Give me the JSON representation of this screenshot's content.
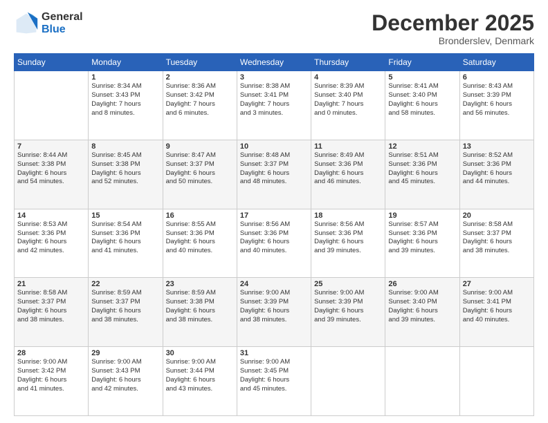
{
  "logo": {
    "general": "General",
    "blue": "Blue"
  },
  "header": {
    "month": "December 2025",
    "location": "Bronderslev, Denmark"
  },
  "days_of_week": [
    "Sunday",
    "Monday",
    "Tuesday",
    "Wednesday",
    "Thursday",
    "Friday",
    "Saturday"
  ],
  "weeks": [
    [
      {
        "day": "",
        "info": ""
      },
      {
        "day": "1",
        "info": "Sunrise: 8:34 AM\nSunset: 3:43 PM\nDaylight: 7 hours\nand 8 minutes."
      },
      {
        "day": "2",
        "info": "Sunrise: 8:36 AM\nSunset: 3:42 PM\nDaylight: 7 hours\nand 6 minutes."
      },
      {
        "day": "3",
        "info": "Sunrise: 8:38 AM\nSunset: 3:41 PM\nDaylight: 7 hours\nand 3 minutes."
      },
      {
        "day": "4",
        "info": "Sunrise: 8:39 AM\nSunset: 3:40 PM\nDaylight: 7 hours\nand 0 minutes."
      },
      {
        "day": "5",
        "info": "Sunrise: 8:41 AM\nSunset: 3:40 PM\nDaylight: 6 hours\nand 58 minutes."
      },
      {
        "day": "6",
        "info": "Sunrise: 8:43 AM\nSunset: 3:39 PM\nDaylight: 6 hours\nand 56 minutes."
      }
    ],
    [
      {
        "day": "7",
        "info": "Sunrise: 8:44 AM\nSunset: 3:38 PM\nDaylight: 6 hours\nand 54 minutes."
      },
      {
        "day": "8",
        "info": "Sunrise: 8:45 AM\nSunset: 3:38 PM\nDaylight: 6 hours\nand 52 minutes."
      },
      {
        "day": "9",
        "info": "Sunrise: 8:47 AM\nSunset: 3:37 PM\nDaylight: 6 hours\nand 50 minutes."
      },
      {
        "day": "10",
        "info": "Sunrise: 8:48 AM\nSunset: 3:37 PM\nDaylight: 6 hours\nand 48 minutes."
      },
      {
        "day": "11",
        "info": "Sunrise: 8:49 AM\nSunset: 3:36 PM\nDaylight: 6 hours\nand 46 minutes."
      },
      {
        "day": "12",
        "info": "Sunrise: 8:51 AM\nSunset: 3:36 PM\nDaylight: 6 hours\nand 45 minutes."
      },
      {
        "day": "13",
        "info": "Sunrise: 8:52 AM\nSunset: 3:36 PM\nDaylight: 6 hours\nand 44 minutes."
      }
    ],
    [
      {
        "day": "14",
        "info": "Sunrise: 8:53 AM\nSunset: 3:36 PM\nDaylight: 6 hours\nand 42 minutes."
      },
      {
        "day": "15",
        "info": "Sunrise: 8:54 AM\nSunset: 3:36 PM\nDaylight: 6 hours\nand 41 minutes."
      },
      {
        "day": "16",
        "info": "Sunrise: 8:55 AM\nSunset: 3:36 PM\nDaylight: 6 hours\nand 40 minutes."
      },
      {
        "day": "17",
        "info": "Sunrise: 8:56 AM\nSunset: 3:36 PM\nDaylight: 6 hours\nand 40 minutes."
      },
      {
        "day": "18",
        "info": "Sunrise: 8:56 AM\nSunset: 3:36 PM\nDaylight: 6 hours\nand 39 minutes."
      },
      {
        "day": "19",
        "info": "Sunrise: 8:57 AM\nSunset: 3:36 PM\nDaylight: 6 hours\nand 39 minutes."
      },
      {
        "day": "20",
        "info": "Sunrise: 8:58 AM\nSunset: 3:37 PM\nDaylight: 6 hours\nand 38 minutes."
      }
    ],
    [
      {
        "day": "21",
        "info": "Sunrise: 8:58 AM\nSunset: 3:37 PM\nDaylight: 6 hours\nand 38 minutes."
      },
      {
        "day": "22",
        "info": "Sunrise: 8:59 AM\nSunset: 3:37 PM\nDaylight: 6 hours\nand 38 minutes."
      },
      {
        "day": "23",
        "info": "Sunrise: 8:59 AM\nSunset: 3:38 PM\nDaylight: 6 hours\nand 38 minutes."
      },
      {
        "day": "24",
        "info": "Sunrise: 9:00 AM\nSunset: 3:39 PM\nDaylight: 6 hours\nand 38 minutes."
      },
      {
        "day": "25",
        "info": "Sunrise: 9:00 AM\nSunset: 3:39 PM\nDaylight: 6 hours\nand 39 minutes."
      },
      {
        "day": "26",
        "info": "Sunrise: 9:00 AM\nSunset: 3:40 PM\nDaylight: 6 hours\nand 39 minutes."
      },
      {
        "day": "27",
        "info": "Sunrise: 9:00 AM\nSunset: 3:41 PM\nDaylight: 6 hours\nand 40 minutes."
      }
    ],
    [
      {
        "day": "28",
        "info": "Sunrise: 9:00 AM\nSunset: 3:42 PM\nDaylight: 6 hours\nand 41 minutes."
      },
      {
        "day": "29",
        "info": "Sunrise: 9:00 AM\nSunset: 3:43 PM\nDaylight: 6 hours\nand 42 minutes."
      },
      {
        "day": "30",
        "info": "Sunrise: 9:00 AM\nSunset: 3:44 PM\nDaylight: 6 hours\nand 43 minutes."
      },
      {
        "day": "31",
        "info": "Sunrise: 9:00 AM\nSunset: 3:45 PM\nDaylight: 6 hours\nand 45 minutes."
      },
      {
        "day": "",
        "info": ""
      },
      {
        "day": "",
        "info": ""
      },
      {
        "day": "",
        "info": ""
      }
    ]
  ]
}
